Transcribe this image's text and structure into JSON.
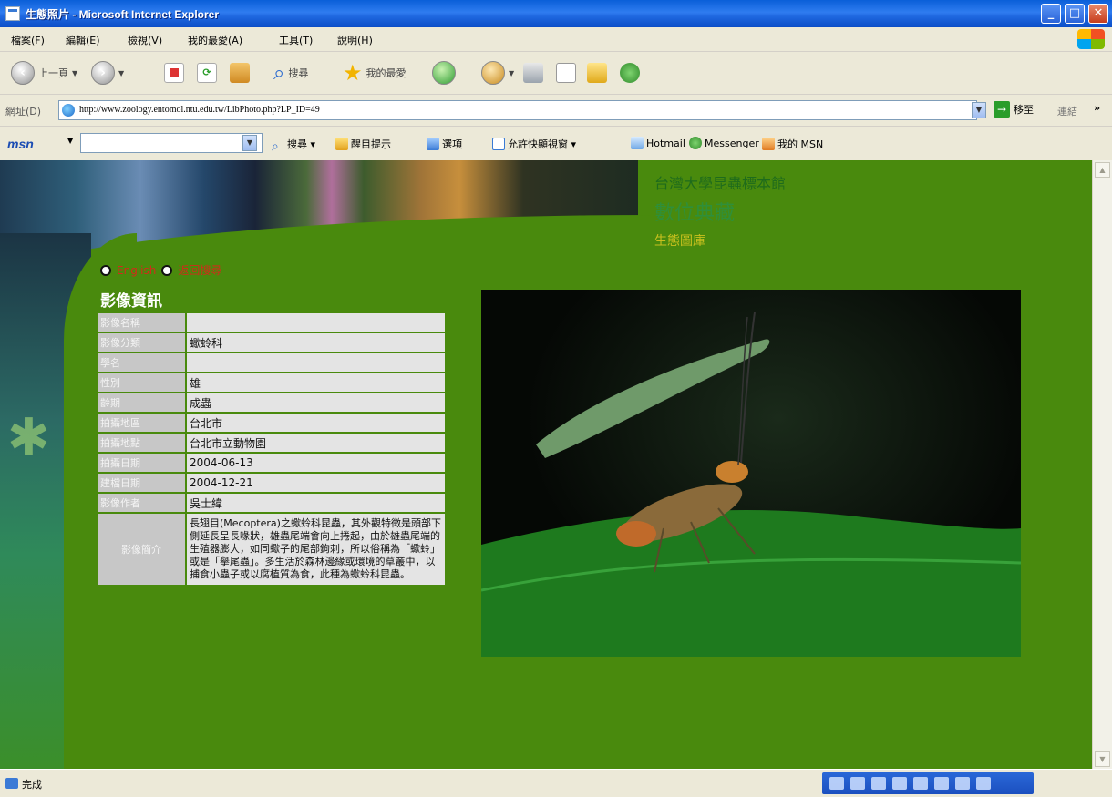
{
  "window": {
    "title": "生態照片 - Microsoft Internet Explorer"
  },
  "menu": {
    "items": [
      "檔案(F)",
      "編輯(E)",
      "檢視(V)",
      "我的最愛(A)",
      "工具(T)",
      "說明(H)"
    ]
  },
  "toolbar": {
    "back_label": "上一頁",
    "search_label": "搜尋",
    "favorites_label": "我的最愛"
  },
  "address": {
    "label": "網址(D)",
    "url": "http://www.zoology.entomol.ntu.edu.tw/LibPhoto.php?LP_ID=49",
    "go_label": "移至",
    "links_label": "連結"
  },
  "msn": {
    "logo": "msn",
    "search_label": "搜尋",
    "popup_label": "醒目提示",
    "options_label": "選項",
    "blocker_label": "允許快顯視窗",
    "hotmail_label": "Hotmail",
    "messenger_label": "Messenger",
    "mymsn_label": "我的 MSN"
  },
  "site": {
    "title_line1": "台灣大學昆蟲標本館",
    "title_line2": "數位典藏",
    "title_line3": "生態圖庫",
    "link_english": "English",
    "link_back": "返回搜尋"
  },
  "info": {
    "heading": "影像資訊",
    "rows": [
      {
        "label": "影像名稱",
        "value": ""
      },
      {
        "label": "影像分類",
        "value": "蠍蛉科"
      },
      {
        "label": "學名",
        "value": ""
      },
      {
        "label": "性別",
        "value": "雄"
      },
      {
        "label": "齡期",
        "value": "成蟲"
      },
      {
        "label": "拍攝地區",
        "value": "台北市"
      },
      {
        "label": "拍攝地點",
        "value": "台北市立動物園"
      },
      {
        "label": "拍攝日期",
        "value": "2004-06-13"
      },
      {
        "label": "建檔日期",
        "value": "2004-12-21"
      },
      {
        "label": "影像作者",
        "value": "吳士緯"
      }
    ],
    "description_label": "影像簡介",
    "description": "長翅目(Mecoptera)之蠍蛉科昆蟲，其外觀特徵是頭部下側延長呈長喙狀，雄蟲尾端會向上捲起，由於雄蟲尾端的生殖器膨大，如同蠍子的尾部鉤刺，所以俗稱為「蠍蛉」或是「擧尾蟲」。多生活於森林邊緣或環境的草叢中，以捕食小蟲子或以腐植質為食，此種為蠍蛉科昆蟲。"
  },
  "status": {
    "text": "完成"
  }
}
